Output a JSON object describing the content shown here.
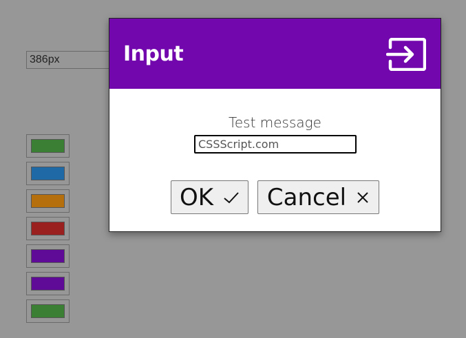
{
  "background": {
    "width_field_value": "386px",
    "color_buttons": [
      {
        "name": "green",
        "color": "#3a7f34"
      },
      {
        "name": "blue",
        "color": "#1f6aa6"
      },
      {
        "name": "orange",
        "color": "#b5700d"
      },
      {
        "name": "red",
        "color": "#9a1f1f"
      },
      {
        "name": "purple",
        "color": "#600a98"
      },
      {
        "name": "purple",
        "color": "#600a98"
      },
      {
        "name": "green",
        "color": "#3a7f34"
      }
    ]
  },
  "dialog": {
    "title": "Input",
    "header_color": "#7207ae",
    "header_icon": "sign-in-icon",
    "message": "Test message",
    "input_value": "CSSScript.com",
    "buttons": {
      "ok_label": "OK",
      "ok_icon": "check-icon",
      "cancel_label": "Cancel",
      "cancel_icon": "close-icon"
    }
  }
}
